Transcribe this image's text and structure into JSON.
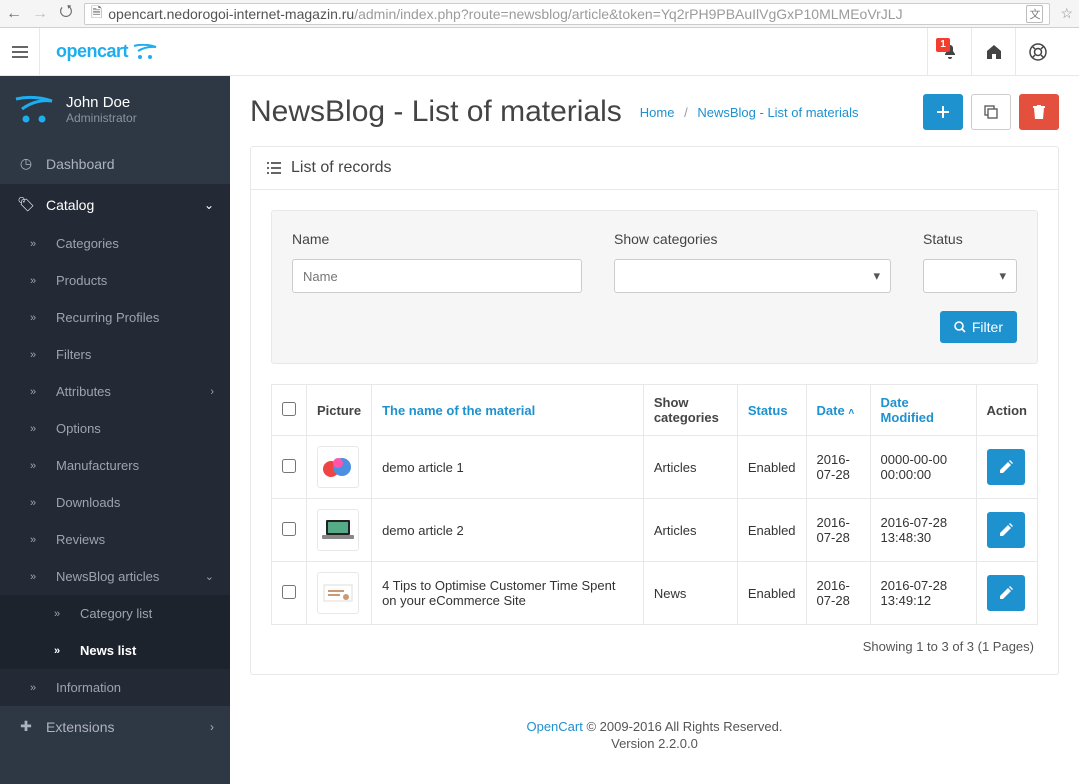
{
  "browser": {
    "url_host": "opencart.nedorogoi-internet-magazin.ru",
    "url_path": "/admin/index.php?route=newsblog/article&token=Yq2rPH9PBAuIlVgGxP10MLMEoVrJLJ"
  },
  "logo": {
    "text": "opencart"
  },
  "topbar": {
    "notif_badge": "1"
  },
  "user": {
    "name": "John Doe",
    "role": "Administrator"
  },
  "sidebar": {
    "dashboard": "Dashboard",
    "catalog": "Catalog",
    "categories": "Categories",
    "products": "Products",
    "recurring": "Recurring Profiles",
    "filters": "Filters",
    "attributes": "Attributes",
    "options": "Options",
    "manufacturers": "Manufacturers",
    "downloads": "Downloads",
    "reviews": "Reviews",
    "newsblog": "NewsBlog articles",
    "category_list": "Category list",
    "news_list": "News list",
    "information": "Information",
    "extensions": "Extensions"
  },
  "page": {
    "title": "NewsBlog - List of materials",
    "bc_home": "Home",
    "bc_sep": "/",
    "bc_current": "NewsBlog - List of materials"
  },
  "panel": {
    "title": "List of records"
  },
  "filter": {
    "name_label": "Name",
    "name_placeholder": "Name",
    "category_label": "Show categories",
    "status_label": "Status",
    "button": "Filter"
  },
  "table": {
    "headers": {
      "picture": "Picture",
      "name": "The name of the material",
      "show_cat": "Show categories",
      "status": "Status",
      "date": "Date",
      "modified": "Date Modified",
      "action": "Action"
    },
    "rows": [
      {
        "name": "demo article 1",
        "cat": "Articles",
        "status": "Enabled",
        "date": "2016-07-28",
        "modified": "0000-00-00 00:00:00"
      },
      {
        "name": "demo article 2",
        "cat": "Articles",
        "status": "Enabled",
        "date": "2016-07-28",
        "modified": "2016-07-28 13:48:30"
      },
      {
        "name": "4 Tips to Optimise Customer Time Spent on your eCommerce Site",
        "cat": "News",
        "status": "Enabled",
        "date": "2016-07-28",
        "modified": "2016-07-28 13:49:12"
      }
    ],
    "pager": "Showing 1 to 3 of 3 (1 Pages)"
  },
  "footer": {
    "link": "OpenCart",
    "copy": " © 2009-2016 All Rights Reserved.",
    "version": "Version 2.2.0.0"
  }
}
